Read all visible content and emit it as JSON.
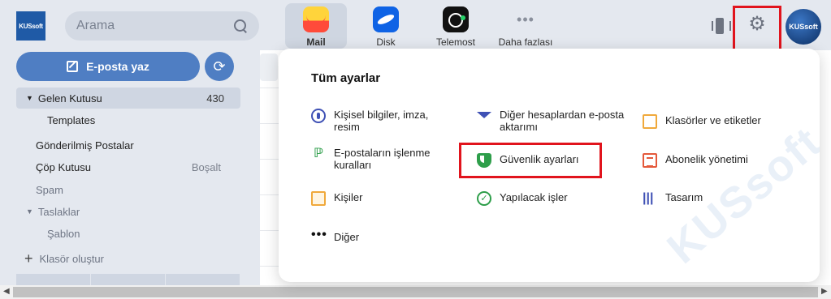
{
  "header": {
    "logo_text": "KUSsoft",
    "search_placeholder": "Arama",
    "apps": [
      {
        "label": "Mail",
        "icon": "mail-icon"
      },
      {
        "label": "Disk",
        "icon": "disk-icon"
      },
      {
        "label": "Telemost",
        "icon": "telemost-icon"
      },
      {
        "label": "Daha fazlası",
        "icon": "more-icon"
      }
    ],
    "avatar_text": "KUSsoft"
  },
  "sidebar": {
    "compose_label": "E-posta yaz",
    "folders": [
      {
        "label": "Gelen Kutusu",
        "count": "430"
      },
      {
        "label": "Templates"
      },
      {
        "label": "Gönderilmiş Postalar"
      },
      {
        "label": "Çöp Kutusu",
        "action": "Boşalt"
      },
      {
        "label": "Spam"
      },
      {
        "label": "Taslaklar"
      },
      {
        "label": "Şablon"
      },
      {
        "label": "Klasör oluştur"
      }
    ]
  },
  "settings_menu": {
    "title": "Tüm ayarlar",
    "items": [
      {
        "label": "Kişisel bilgiler, imza, resim",
        "icon": "user-circle-icon"
      },
      {
        "label": "Diğer hesaplardan e-posta aktarımı",
        "icon": "funnel-icon"
      },
      {
        "label": "Klasörler ve etiketler",
        "icon": "folder-icon"
      },
      {
        "label": "E-postaların işlenme kuralları",
        "icon": "rules-icon"
      },
      {
        "label": "Güvenlik ayarları",
        "icon": "shield-icon"
      },
      {
        "label": "Abonelik yönetimi",
        "icon": "subscription-icon"
      },
      {
        "label": "Kişiler",
        "icon": "contacts-icon"
      },
      {
        "label": "Yapılacak işler",
        "icon": "check-circle-icon"
      },
      {
        "label": "Tasarım",
        "icon": "design-icon"
      },
      {
        "label": "Diğer",
        "icon": "dots-icon"
      }
    ],
    "watermark": "KUSsoft"
  },
  "colors": {
    "accent": "#4f7ec3",
    "highlight": "#e1141d"
  }
}
